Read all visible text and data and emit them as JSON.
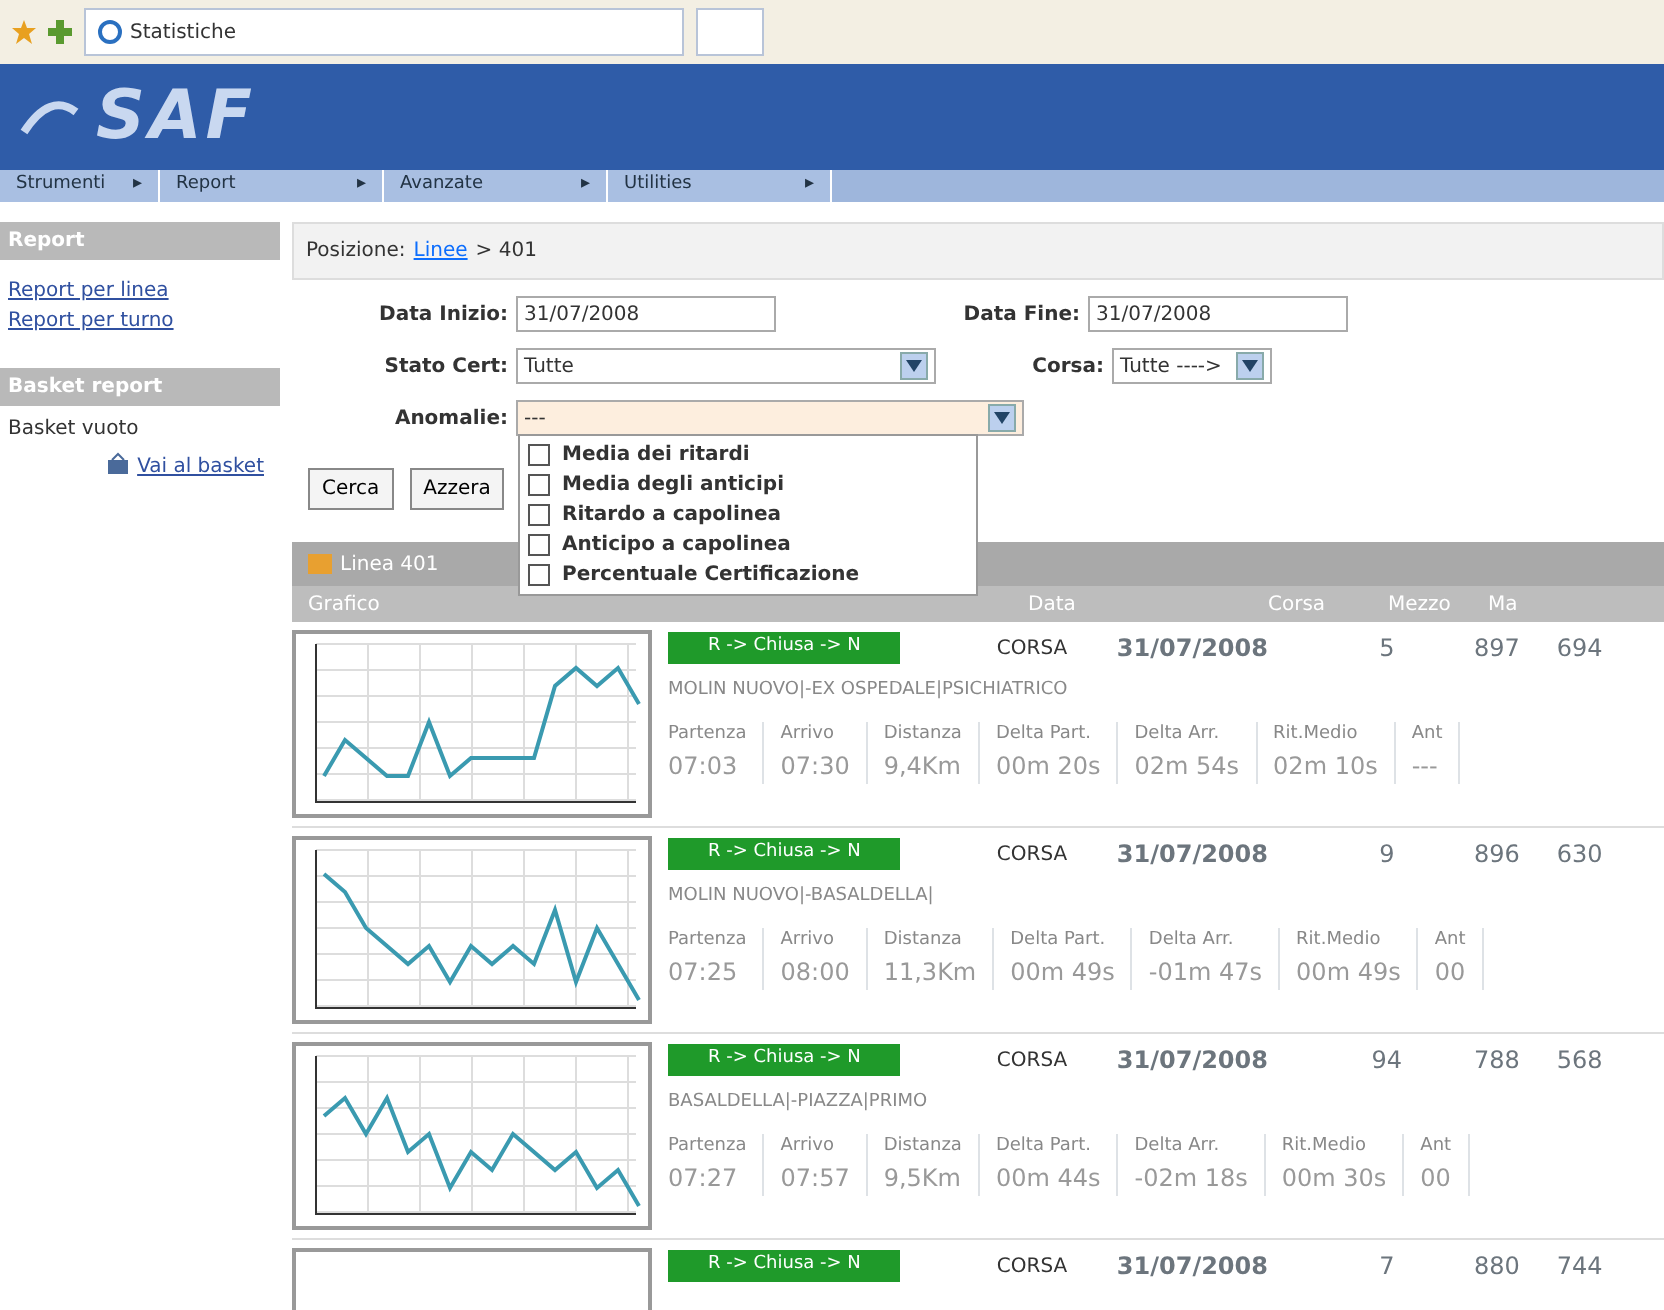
{
  "browser": {
    "tab_title": "Statistiche"
  },
  "banner": {
    "logo": "SAF"
  },
  "menu": [
    {
      "label": "Strumenti",
      "arrow": "▸"
    },
    {
      "label": "Report",
      "arrow": "▸"
    },
    {
      "label": "Avanzate",
      "arrow": "▸"
    },
    {
      "label": "Utilities",
      "arrow": "▸"
    }
  ],
  "sidebar": {
    "report_header": "Report",
    "links": [
      "Report per linea",
      "Report per turno"
    ],
    "basket_header": "Basket report",
    "basket_status": "Basket vuoto",
    "basket_link": "Vai al basket"
  },
  "breadcrumb": {
    "label": "Posizione:",
    "link": "Linee",
    "rest": "> 401"
  },
  "form": {
    "start_label": "Data Inizio:",
    "start_value": "31/07/2008",
    "end_label": "Data Fine:",
    "end_value": "31/07/2008",
    "state_label": "Stato Cert:",
    "state_value": "Tutte",
    "run_label": "Corsa:",
    "run_value": "Tutte ---->",
    "anomaly_label": "Anomalie:",
    "anomaly_value": "---",
    "anomaly_options": [
      {
        "label": "Media dei ritardi",
        "checked": false
      },
      {
        "label": "Media degli anticipi",
        "checked": false
      },
      {
        "label": "Ritardo a capolinea",
        "checked": false
      },
      {
        "label": "Anticipo a capolinea",
        "checked": false
      },
      {
        "label": "Percentuale Certificazione",
        "checked": false
      }
    ],
    "buttons": [
      "Cerca",
      "Azzera"
    ]
  },
  "results": {
    "title": "Linea 401",
    "columns": [
      "Grafico",
      "Data",
      "Corsa",
      "Mezzo",
      "Ma"
    ],
    "rows": [
      {
        "status": "R -> Chiusa -> N",
        "type": "CORSA",
        "date": "31/07/2008",
        "run": "5",
        "vehicle": "897",
        "extra": "694",
        "route": "MOLIN NUOVO|-EX OSPEDALE|PSICHIATRICO",
        "stats": [
          [
            "Partenza",
            "07:03"
          ],
          [
            "Arrivo",
            "07:30"
          ],
          [
            "Distanza",
            "9,4Km"
          ],
          [
            "Delta Part.",
            "00m 20s"
          ],
          [
            "Delta Arr.",
            "02m 54s"
          ],
          [
            "Rit.Medio",
            "02m 10s"
          ],
          [
            "Ant",
            "---"
          ]
        ]
      },
      {
        "status": "R -> Chiusa -> N",
        "type": "CORSA",
        "date": "31/07/2008",
        "run": "9",
        "vehicle": "896",
        "extra": "630",
        "route": "MOLIN NUOVO|-BASALDELLA|",
        "stats": [
          [
            "Partenza",
            "07:25"
          ],
          [
            "Arrivo",
            "08:00"
          ],
          [
            "Distanza",
            "11,3Km"
          ],
          [
            "Delta Part.",
            "00m 49s"
          ],
          [
            "Delta Arr.",
            "-01m 47s"
          ],
          [
            "Rit.Medio",
            "00m 49s"
          ],
          [
            "Ant",
            "00"
          ]
        ]
      },
      {
        "status": "R -> Chiusa -> N",
        "type": "CORSA",
        "date": "31/07/2008",
        "run": "94",
        "vehicle": "788",
        "extra": "568",
        "route": "BASALDELLA|-PIAZZA|PRIMO",
        "stats": [
          [
            "Partenza",
            "07:27"
          ],
          [
            "Arrivo",
            "07:57"
          ],
          [
            "Distanza",
            "9,5Km"
          ],
          [
            "Delta Part.",
            "00m 44s"
          ],
          [
            "Delta Arr.",
            "-02m 18s"
          ],
          [
            "Rit.Medio",
            "00m 30s"
          ],
          [
            "Ant",
            "00"
          ]
        ]
      },
      {
        "status": "R -> Chiusa -> N",
        "type": "CORSA",
        "date": "31/07/2008",
        "run": "7",
        "vehicle": "880",
        "extra": "744"
      }
    ]
  }
}
